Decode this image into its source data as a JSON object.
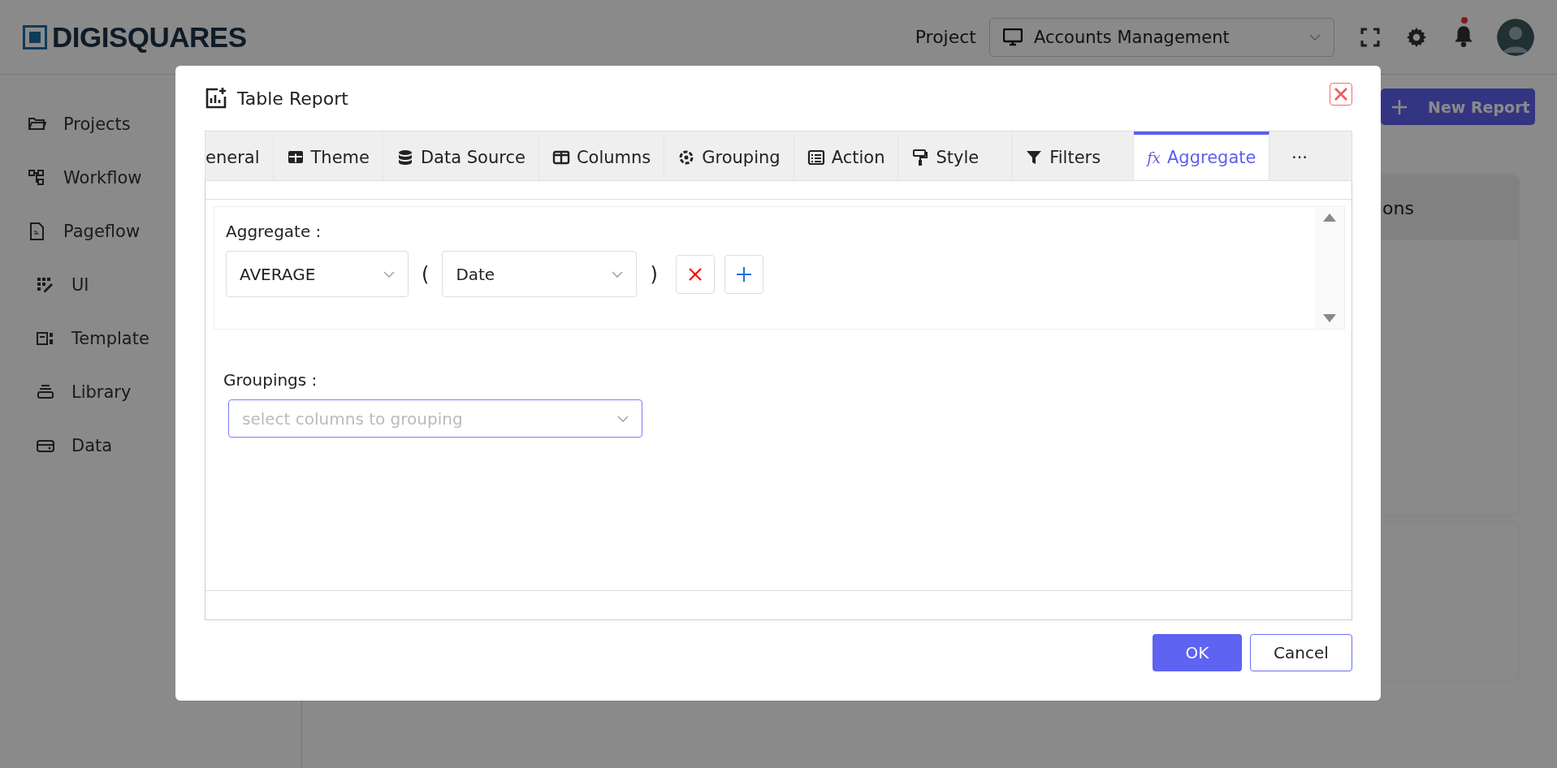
{
  "header": {
    "logo": "DIGISQUARES",
    "project_label": "Project",
    "project_select": "Accounts Management"
  },
  "sidebar": {
    "items": [
      {
        "label": "Projects",
        "sub": false
      },
      {
        "label": "Workflow",
        "sub": false
      },
      {
        "label": "Pageflow",
        "sub": false
      },
      {
        "label": "UI",
        "sub": true
      },
      {
        "label": "Template",
        "sub": true
      },
      {
        "label": "Library",
        "sub": true
      },
      {
        "label": "Data",
        "sub": true
      }
    ]
  },
  "main": {
    "new_report_button": "New Report",
    "card_heading": "ons"
  },
  "dialog": {
    "title": "Table Report",
    "tabs": [
      {
        "label": "eneral",
        "selected": false
      },
      {
        "label": "Theme",
        "selected": false
      },
      {
        "label": "Data Source",
        "selected": false
      },
      {
        "label": "Columns",
        "selected": false
      },
      {
        "label": "Grouping",
        "selected": false
      },
      {
        "label": "Action",
        "selected": false
      },
      {
        "label": "Style",
        "selected": false
      },
      {
        "label": "Filters",
        "selected": false
      },
      {
        "label": "Aggregate",
        "selected": true,
        "glyph": "fx"
      }
    ],
    "more": "···",
    "aggregate_label": "Aggregate :",
    "aggregates": [
      {
        "function": "AVERAGE",
        "open": "(",
        "column": "Date",
        "close": ")"
      }
    ],
    "groupings_label": "Groupings :",
    "groupings_placeholder": "select columns to grouping",
    "ok": "OK",
    "cancel": "Cancel"
  }
}
